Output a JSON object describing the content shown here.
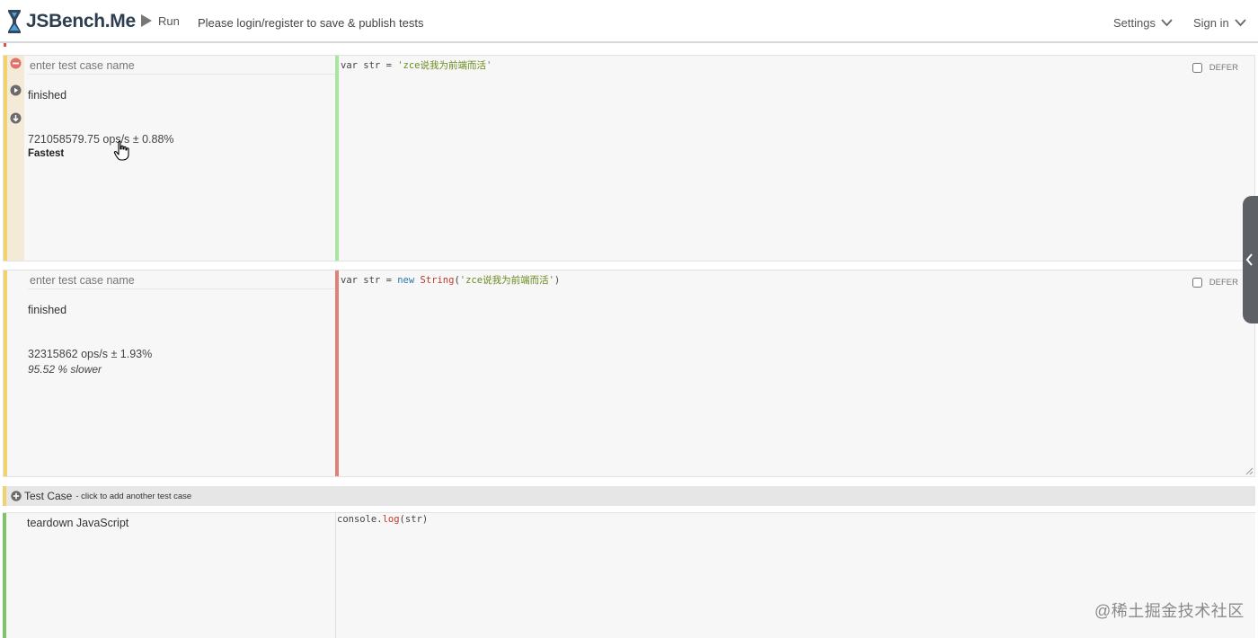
{
  "app": {
    "brand": "JSBench.Me",
    "run_label": "Run",
    "login_note": "Please login/register to save & publish tests",
    "settings_label": "Settings",
    "signin_label": "Sign in"
  },
  "test_cases": [
    {
      "name_placeholder": "enter test case name",
      "status": "finished",
      "result": "721058579.75 ops/s ± 0.88%",
      "verdict": "Fastest",
      "code": {
        "prefix": "var str = ",
        "string": "'zce说我为前端而活'"
      },
      "defer_label": "DEFER",
      "stripe_color": "#f0d36c",
      "code_bar_color": "#a8e6a0"
    },
    {
      "name_placeholder": "enter test case name",
      "status": "finished",
      "result": "32315862 ops/s ± 1.93%",
      "verdict": "95.52 % slower",
      "code": {
        "prefix": "var str = ",
        "kw_new": "new",
        "fn": "String",
        "open": "(",
        "string": "'zce说我为前端而活'",
        "close": ")"
      },
      "defer_label": "DEFER",
      "stripe_color": "#f0d36c",
      "code_bar_color": "#e0807a"
    }
  ],
  "add_case": {
    "label": "Test Case",
    "hint": "- click to add another test case"
  },
  "teardown": {
    "label": "teardown JavaScript",
    "code": {
      "obj": "console.",
      "fn": "log",
      "args": "(str)"
    }
  },
  "watermark": "@稀土掘金技术社区"
}
